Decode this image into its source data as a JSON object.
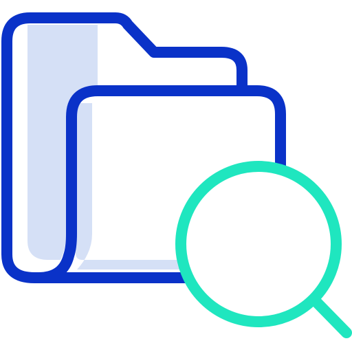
{
  "icon": {
    "name": "folder-search-icon",
    "parts": [
      "folder-back-icon",
      "folder-front-icon",
      "magnifier-icon"
    ]
  },
  "colors": {
    "background": "#ffffff",
    "folder_stroke": "#0a32c8",
    "folder_fill": "#d5e0f6",
    "magnifier_stroke": "#1fe6bf"
  }
}
